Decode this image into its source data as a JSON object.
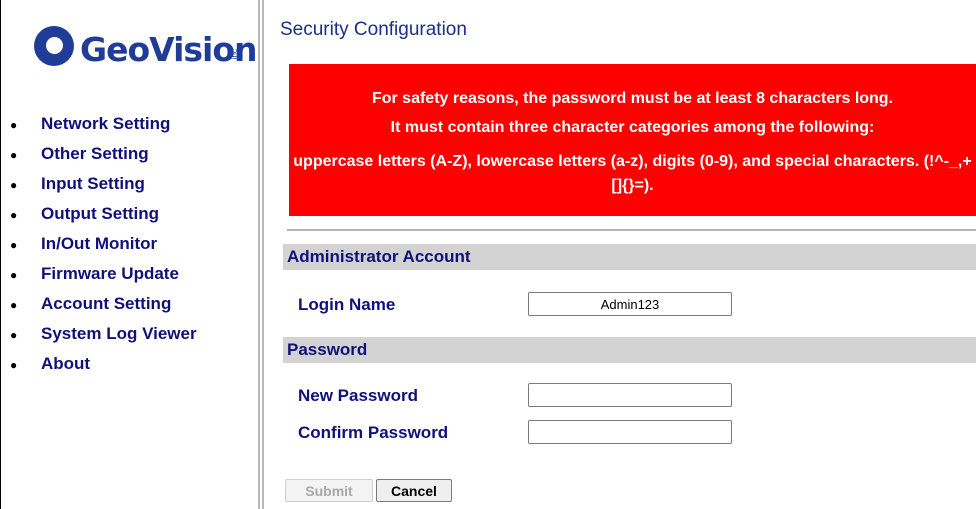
{
  "brand": {
    "logo_text": "GeoVision",
    "logo_suffix": "inc"
  },
  "sidebar": {
    "items": [
      {
        "label": "Network Setting"
      },
      {
        "label": "Other Setting"
      },
      {
        "label": "Input Setting"
      },
      {
        "label": "Output Setting"
      },
      {
        "label": "In/Out Monitor"
      },
      {
        "label": "Firmware Update"
      },
      {
        "label": "Account Setting"
      },
      {
        "label": "System Log Viewer"
      },
      {
        "label": "About"
      }
    ]
  },
  "main": {
    "title": "Security Configuration",
    "warning": {
      "line1": "For safety reasons, the password must be at least 8 characters long.",
      "line2": "It must contain three character categories among the following:",
      "line3": "uppercase letters (A-Z), lowercase letters (a-z), digits (0-9), and special characters. (!^-_,+[]{}=).",
      "color": "#ff0000"
    },
    "admin_section": {
      "heading": "Administrator Account",
      "login_label": "Login Name",
      "login_value": "Admin123"
    },
    "password_section": {
      "heading": "Password",
      "new_label": "New Password",
      "new_value": "",
      "confirm_label": "Confirm Password",
      "confirm_value": ""
    },
    "buttons": {
      "submit": "Submit",
      "cancel": "Cancel"
    }
  },
  "colors": {
    "nav_text": "#10107a",
    "section_bar": "#d3d3d3",
    "logo": "#1f3d98"
  }
}
